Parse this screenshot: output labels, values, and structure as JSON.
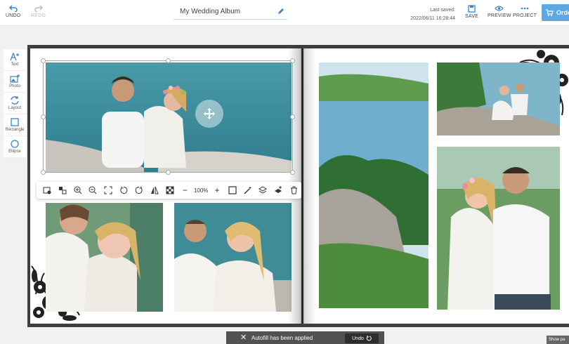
{
  "header": {
    "undo_label": "UNDO",
    "redo_label": "REDO",
    "album_title": "My Wedding Album",
    "last_saved_label": "Last saved:",
    "last_saved_time": "2022/06/11 16:28:44",
    "save_label": "SAVE",
    "preview_label": "PREVIEW",
    "project_label": "PROJECT",
    "order_label": "Orde"
  },
  "tools": [
    {
      "label": "Text",
      "icon": "text-add-icon"
    },
    {
      "label": "Photo",
      "icon": "photo-add-icon"
    },
    {
      "label": "Layout",
      "icon": "layout-icon"
    },
    {
      "label": "Rectangle",
      "icon": "rectangle-icon"
    },
    {
      "label": "Ellipse",
      "icon": "ellipse-icon"
    }
  ],
  "photo_toolbar": {
    "zoom_value": "100%",
    "zoom_minus": "−",
    "zoom_plus": "+"
  },
  "toast": {
    "message": "Autofill has been applied",
    "undo_label": "Undo"
  },
  "show_page_label": "Show pa",
  "colors": {
    "accent": "#5aa9e6",
    "album_frame": "#3d3d3d",
    "toast_bg": "#515151"
  }
}
